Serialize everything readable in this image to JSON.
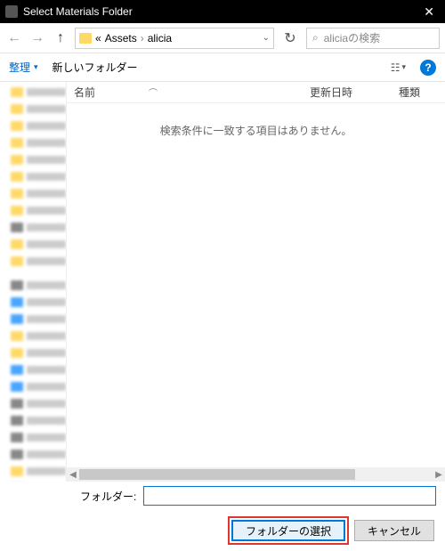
{
  "titlebar": {
    "title": "Select Materials Folder"
  },
  "nav": {
    "path_prefix": "«",
    "crumbs": [
      "Assets",
      "alicia"
    ],
    "search_placeholder": "aliciaの検索"
  },
  "toolbar": {
    "organize": "整理",
    "new_folder": "新しいフォルダー"
  },
  "columns": {
    "name": "名前",
    "date": "更新日時",
    "type": "種類"
  },
  "empty_message": "検索条件に一致する項目はありません。",
  "folder": {
    "label": "フォルダー:",
    "value": ""
  },
  "buttons": {
    "select": "フォルダーの選択",
    "cancel": "キャンセル"
  }
}
